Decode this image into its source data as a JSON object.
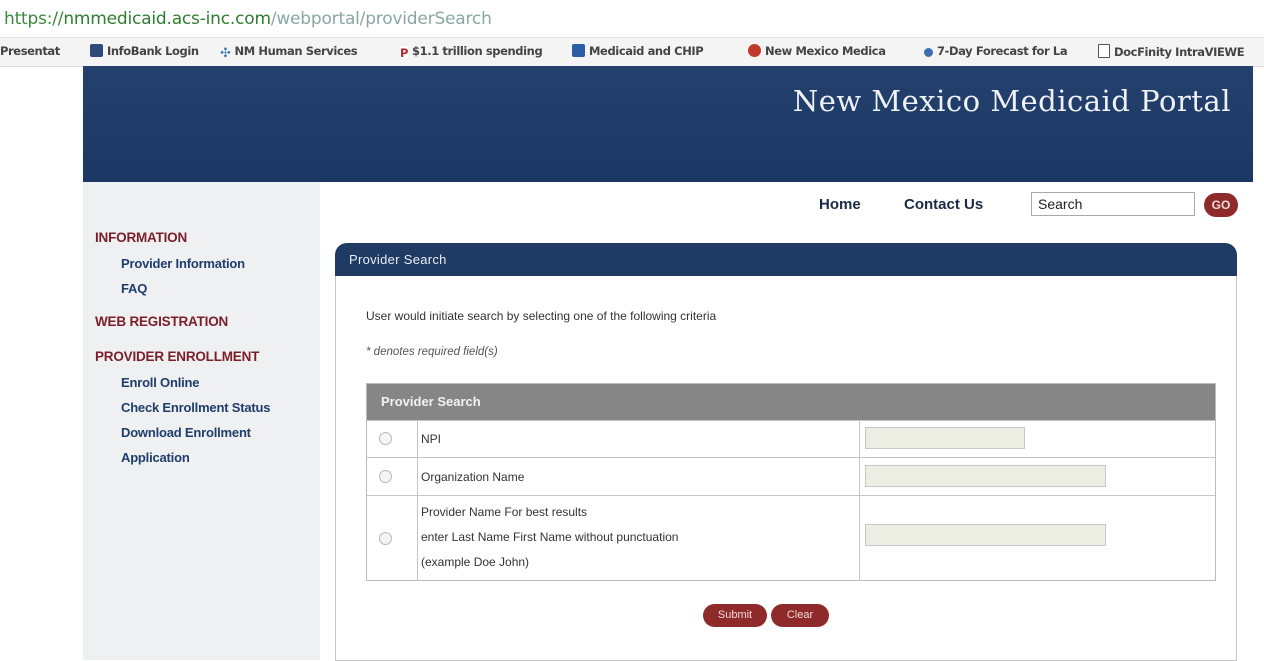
{
  "browser": {
    "url_protocol": "https://",
    "url_host": "nmmedicaid.acs-inc.com",
    "url_path": "/webportal/providerSearch",
    "bookmarks": [
      {
        "label": "Presentat",
        "icon": "page-icon",
        "color": "#9a9a9a"
      },
      {
        "label": "InfoBank Login",
        "icon": "infobank-icon",
        "color": "#2e4a7a"
      },
      {
        "label": "NM Human Services",
        "icon": "nm-hsd-icon",
        "color": "#4a7db5"
      },
      {
        "label": "$1.1 trillion spending",
        "icon": "politico-icon",
        "color": "#b3282d"
      },
      {
        "label": "Medicaid and CHIP",
        "icon": "medicaid-icon",
        "color": "#2c5ea8"
      },
      {
        "label": "New Mexico Medica",
        "icon": "nm-medicaid-icon",
        "color": "#c0392b"
      },
      {
        "label": "7-Day Forecast for La",
        "icon": "weather-icon",
        "color": "#3a6fb0"
      },
      {
        "label": "DocFinity IntraVIEWE",
        "icon": "document-icon",
        "color": "#555555"
      }
    ]
  },
  "site": {
    "title": "New Mexico Medicaid Portal",
    "nav": {
      "home": "Home",
      "contact": "Contact Us"
    },
    "search": {
      "placeholder": "Search",
      "go": "GO"
    },
    "brand_color": "#1f3a63",
    "accent_color": "#8e2a2a"
  },
  "sidebar": {
    "information": "INFORMATION",
    "provider_information": "Provider Information",
    "faq": "FAQ",
    "web_registration": "WEB REGISTRATION",
    "provider_enrollment": "PROVIDER ENROLLMENT",
    "enroll_online": "Enroll Online",
    "check_status": "Check Enrollment Status",
    "download_enrollment": "Download Enrollment",
    "application": "Application"
  },
  "main": {
    "panel_title": "Provider Search",
    "intro": "User would initiate search by selecting one of the following criteria",
    "required_note": "* denotes required field(s)",
    "table_title": "Provider Search",
    "rows": {
      "npi": "NPI",
      "org": "Organization Name",
      "provider_line1": "Provider Name   For best results",
      "provider_line2": "enter Last Name First Name without punctuation",
      "provider_line3": "(example  Doe John)"
    },
    "submit": "Submit",
    "clear": "Clear"
  }
}
